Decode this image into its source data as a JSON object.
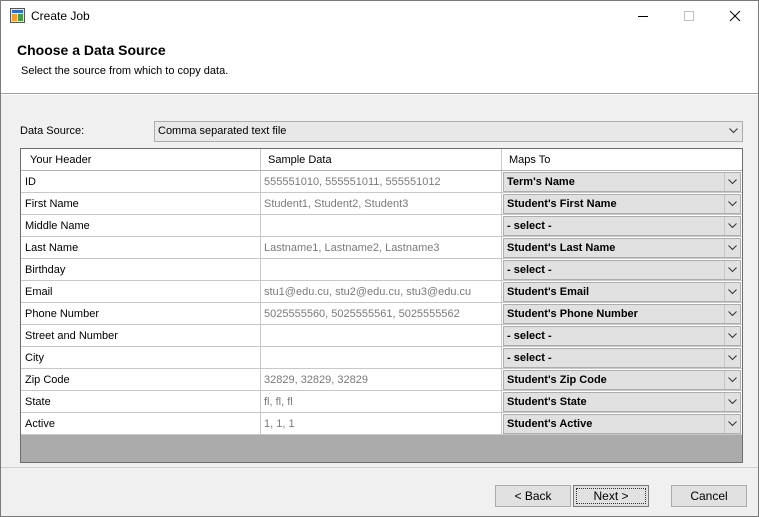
{
  "window": {
    "title": "Create Job"
  },
  "header": {
    "title": "Choose a Data Source",
    "subtitle": "Select the source from which to copy data."
  },
  "data_source": {
    "label": "Data Source:",
    "value": "Comma separated text file"
  },
  "grid": {
    "columns": [
      "Your Header",
      "Sample Data",
      "Maps To"
    ],
    "rows": [
      {
        "header": "ID",
        "sample": "555551010, 555551011, 555551012",
        "maps_to": "Term's Name"
      },
      {
        "header": "First Name",
        "sample": "Student1, Student2, Student3",
        "maps_to": "Student's First Name"
      },
      {
        "header": "Middle Name",
        "sample": "",
        "maps_to": "- select -"
      },
      {
        "header": "Last Name",
        "sample": "Lastname1, Lastname2, Lastname3",
        "maps_to": "Student's Last Name"
      },
      {
        "header": "Birthday",
        "sample": "",
        "maps_to": "- select -"
      },
      {
        "header": "Email",
        "sample": "stu1@edu.cu, stu2@edu.cu, stu3@edu.cu",
        "maps_to": "Student's Email"
      },
      {
        "header": "Phone Number",
        "sample": "5025555560, 5025555561, 5025555562",
        "maps_to": "Student's Phone Number"
      },
      {
        "header": "Street and Number",
        "sample": "",
        "maps_to": "- select -"
      },
      {
        "header": "City",
        "sample": "",
        "maps_to": "- select -"
      },
      {
        "header": "Zip Code",
        "sample": "32829, 32829, 32829",
        "maps_to": "Student's Zip Code"
      },
      {
        "header": "State",
        "sample": "fl, fl, fl",
        "maps_to": "Student's State"
      },
      {
        "header": "Active",
        "sample": "1, 1, 1",
        "maps_to": "Student's Active"
      }
    ]
  },
  "buttons": {
    "back": "< Back",
    "next": "Next >",
    "cancel": "Cancel"
  },
  "icons": {
    "app": "app-window-icon",
    "minimize": "minimize-icon",
    "maximize": "maximize-icon",
    "close": "close-icon",
    "dropdown": "chevron-down-icon"
  }
}
